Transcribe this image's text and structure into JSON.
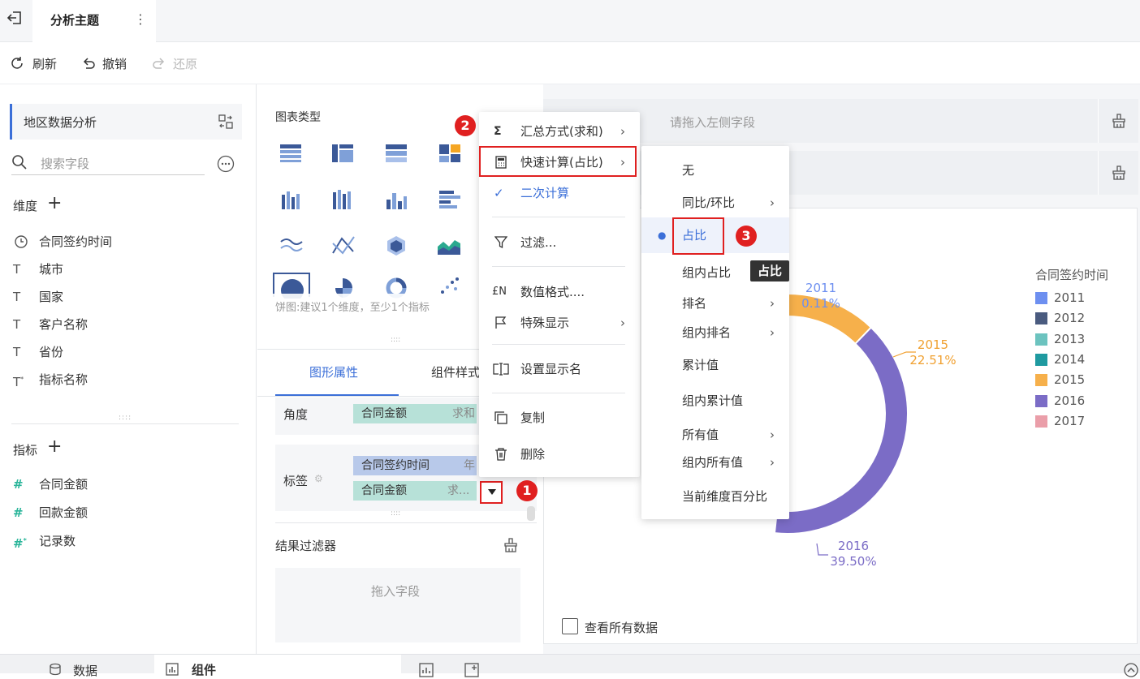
{
  "header": {
    "title": "分析主题"
  },
  "toolbar": {
    "refresh": "刷新",
    "undo": "撤销",
    "redo": "还原"
  },
  "left": {
    "dataset": "地区数据分析",
    "search_placeholder": "搜索字段",
    "dimension_title": "维度",
    "dimensions": [
      {
        "icon": "clock-icon",
        "label": "合同签约时间"
      },
      {
        "icon": "text-icon",
        "label": "城市"
      },
      {
        "icon": "text-icon",
        "label": "国家"
      },
      {
        "icon": "text-icon",
        "label": "客户名称"
      },
      {
        "icon": "text-icon",
        "label": "省份"
      },
      {
        "icon": "text-star-icon",
        "label": "指标名称"
      }
    ],
    "measure_title": "指标",
    "measures": [
      {
        "icon": "hash-icon",
        "label": "合同金额"
      },
      {
        "icon": "hash-icon",
        "label": "回款金额"
      },
      {
        "icon": "hash-star-icon",
        "label": "记录数"
      }
    ]
  },
  "mid": {
    "chart_type_title": "图表类型",
    "hint": "饼图:建议1个维度，至少1个指标",
    "tabs": [
      "图形属性",
      "组件样式"
    ],
    "angle_label": "角度",
    "angle_field": "合同金额",
    "angle_agg": "求和",
    "label_label": "标签",
    "label_fields": [
      {
        "name": "合同签约时间",
        "agg": "年"
      },
      {
        "name": "合同金额",
        "agg": "求..."
      }
    ],
    "filter_title": "结果过滤器",
    "filter_placeholder": "拖入字段"
  },
  "right": {
    "drop_placeholder": "请拖入左侧字段",
    "view_all": "查看所有数据",
    "legend_title": "合同签约时间"
  },
  "context_menu": {
    "items": [
      "汇总方式(求和)",
      "快速计算(占比)",
      "二次计算",
      "过滤...",
      "数值格式....",
      "特殊显示",
      "设置显示名",
      "复制",
      "删除"
    ]
  },
  "submenu": {
    "items": [
      "无",
      "同比/环比",
      "占比",
      "组内占比",
      "排名",
      "组内排名",
      "累计值",
      "组内累计值",
      "所有值",
      "组内所有值",
      "当前维度百分比"
    ],
    "tooltip": "占比"
  },
  "badges": [
    "1",
    "2",
    "3"
  ],
  "bottom": {
    "tabs": [
      "数据",
      "组件"
    ]
  },
  "chart_data": {
    "type": "pie",
    "title": "",
    "legend_title": "合同签约时间",
    "legend_position": "right",
    "categories": [
      "2011",
      "2012",
      "2013",
      "2014",
      "2015",
      "2016",
      "2017"
    ],
    "colors": [
      "#6d8ff0",
      "#4a5b7f",
      "#6cc3bf",
      "#1f9aa0",
      "#f6b04b",
      "#7b6cc6",
      "#ea9ea9"
    ],
    "visible_labels": [
      {
        "category": "2011",
        "percent": "0.11%"
      },
      {
        "category": "2015",
        "percent": "22.51%"
      },
      {
        "category": "2016",
        "percent": "39.50%"
      }
    ]
  }
}
